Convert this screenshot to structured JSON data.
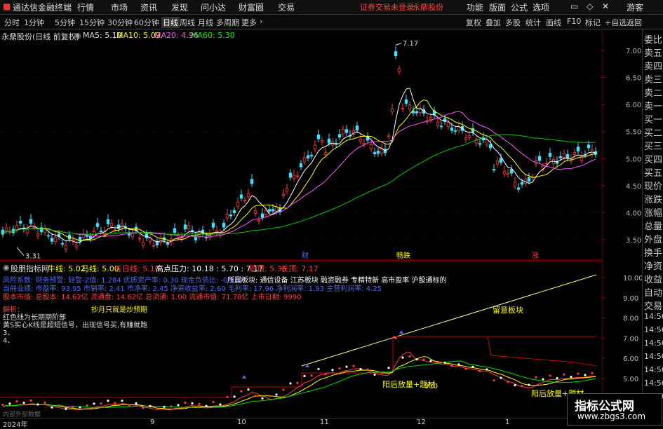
{
  "menubar": {
    "app_name": "通达信金融终端",
    "items": [
      "行情",
      "市场",
      "资讯",
      "发现",
      "问小达",
      "财富圈",
      "交易"
    ],
    "notice": "证券交易未登录",
    "stock": "永鼎股份",
    "right_items": [
      "功能",
      "版面",
      "公式",
      "选项"
    ],
    "user": "游客"
  },
  "toolbar": {
    "periods": [
      "分时",
      "1分钟",
      "5分钟",
      "15分钟",
      "30分钟",
      "60分钟",
      "日线",
      "周线",
      "月线",
      "多周期",
      "更多"
    ],
    "active": "日线",
    "right_buttons": [
      "复权",
      "叠加",
      "多股",
      "统计",
      "画线",
      "F10",
      "标记",
      "+自选",
      "返回"
    ]
  },
  "main": {
    "title": "永鼎股份(日线 前复权)",
    "ma": [
      {
        "label": "MA5: 5.10",
        "color": "#ffffff"
      },
      {
        "label": "MA10: 5.09",
        "color": "#ffff00"
      },
      {
        "label": "MA20: 4.96",
        "color": "#ff55ff"
      },
      {
        "label": "MA60: 5.30",
        "color": "#00ff00"
      }
    ],
    "high_label": "7.17",
    "low_label": "3.31",
    "events": [
      {
        "label": "财",
        "color": "#4a6cf0"
      },
      {
        "label": "畅跌",
        "color": "#ffff00"
      },
      {
        "label": "涨",
        "color": "#ff4040"
      }
    ],
    "y_ticks": [
      "7.00",
      "6.50",
      "6.00",
      "5.50",
      "5.00",
      "4.50",
      "4.00",
      "3.50"
    ]
  },
  "indicator": {
    "name": "股朋指标网",
    "values": [
      {
        "label": "牛线: 5.02",
        "color": "#ffff00"
      },
      {
        "label": "马线: 5.00",
        "color": "#ffff00"
      },
      {
        "label": "五日线: 5.10",
        "color": "#ff4040"
      },
      {
        "label": "高点压力: 10.18 : 5.70 : 7.17",
        "color": "#ffffff"
      },
      {
        "label": "短顶: 5.36",
        "color": "#ff4040"
      },
      {
        "label": "长顶: 7.17",
        "color": "#ff4040"
      }
    ],
    "info_lines": [
      {
        "text": "风险系数: 财务预警: 轻警-Z值: 1.284 优质资产率: 0.30 现金负债比: -0.114",
        "color": "#4a6cf0"
      },
      {
        "text": "所属板块: 通信设备 江苏板块 融资融券 专精特新 高市盈率 沪股通标的",
        "color": "#ffffff"
      },
      {
        "text": "当前业绩: 市盈率: 93.95 市销率: 2.41 市净率: 2.45 净资收益率: 2.60 毛利率: 17.96 净利润率: 1.93 主营利润率: 4.25",
        "color": "#4a6cf0"
      },
      {
        "text": "股本市值: 总股本: 14.62亿 流通盘: 14.62亿 总流通: 1.00 流通市值: 71.78亿 上市日期: 9990",
        "color": "#ff4040"
      }
    ],
    "notes": [
      {
        "text": "解析：",
        "color": "#ff4040"
      },
      {
        "text": "红色线为长期期阶部",
        "color": "#dddddd"
      },
      {
        "text": "抄月只就是炒预期",
        "color": "#ffff00"
      },
      {
        "text": "黄S实心K线是超短信号，出现信号买,有赚就跑",
        "color": "#dddddd"
      },
      {
        "text": "3、",
        "color": "#dddddd"
      },
      {
        "text": "4、",
        "color": "#dddddd"
      }
    ],
    "annot_trend": "留意板块",
    "annot_buy1": "阳后放量+题材",
    "annot_buy2": "阳后放量+题材",
    "annot_num": "910",
    "y_ticks": [
      "10.00",
      "9.00",
      "8.00",
      "7.00",
      "6.00",
      "5.00"
    ]
  },
  "side": [
    "委比",
    "卖五",
    "卖四",
    "卖三",
    "卖二",
    "卖一",
    "买一",
    "买二",
    "买三",
    "买四",
    "买五",
    "现价",
    "涨跌",
    "涨幅",
    "总量",
    "外盘",
    "换手",
    "净资",
    "收益",
    "自动",
    "交易",
    "14:56",
    "14:56",
    "14:56",
    "14:56",
    "14:56",
    "14:56",
    "14:56"
  ],
  "bottom": {
    "labels": [
      "2024年",
      "9",
      "10",
      "11",
      "12",
      "1"
    ],
    "note": "内部外部数据"
  },
  "watermark": {
    "title": "指标公式网",
    "url": "www.zbgs3.com"
  }
}
